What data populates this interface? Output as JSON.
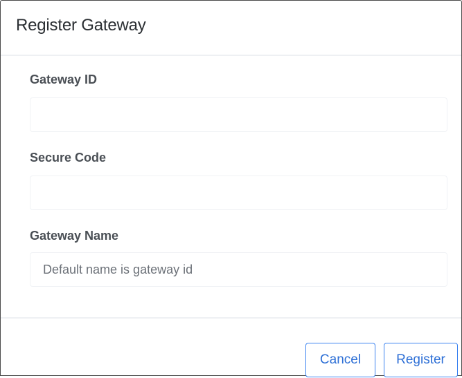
{
  "dialog": {
    "title": "Register Gateway"
  },
  "form": {
    "gateway_id": {
      "label": "Gateway ID",
      "value": "",
      "placeholder": ""
    },
    "secure_code": {
      "label": "Secure Code",
      "value": "",
      "placeholder": ""
    },
    "gateway_name": {
      "label": "Gateway Name",
      "value": "",
      "placeholder": "Default name is gateway id"
    }
  },
  "footer": {
    "cancel_label": "Cancel",
    "register_label": "Register"
  },
  "colors": {
    "accent": "#3a82f0",
    "title_text": "#2b2f33",
    "label_text": "#4a4f55",
    "divider": "#eef0f3"
  }
}
